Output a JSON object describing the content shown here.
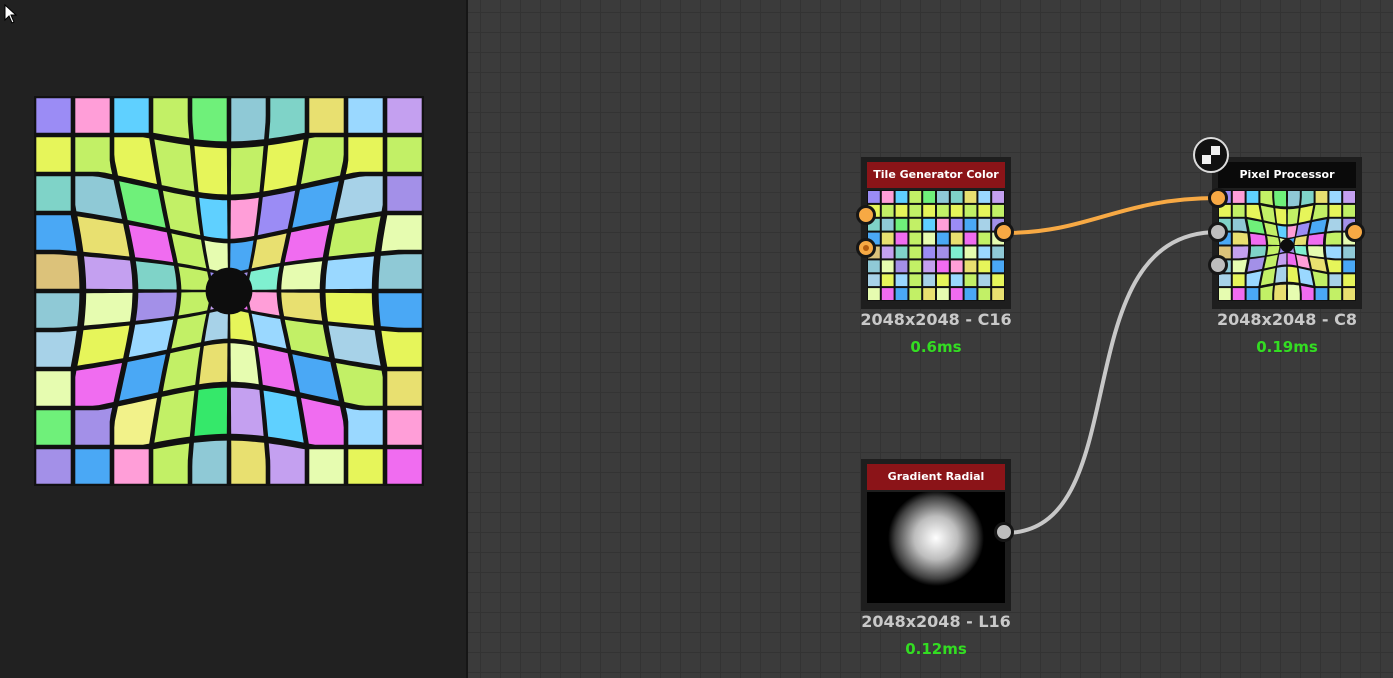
{
  "colors": {
    "panel_bg": "#212121",
    "canvas_bg": "#3b3b3b",
    "header_red": "#8b1418",
    "port_orange": "#f7a944",
    "port_gray": "#bdbdbd",
    "time_green": "#33dd22"
  },
  "preview": {
    "cursor_icon": "arrow-cursor-icon",
    "image": "warped-tile-grid-preview"
  },
  "nodes": {
    "tile_generator": {
      "title": "Tile Generator Color",
      "info": "2048x2048 - C16",
      "time": "0.6ms"
    },
    "pixel_processor": {
      "title": "Pixel Processor",
      "info": "2048x2048 - C8",
      "time": "0.19ms",
      "badge_icon": "checker-output-icon"
    },
    "gradient_radial": {
      "title": "Gradient Radial",
      "info": "2048x2048 - L16",
      "time": "0.12ms"
    }
  }
}
